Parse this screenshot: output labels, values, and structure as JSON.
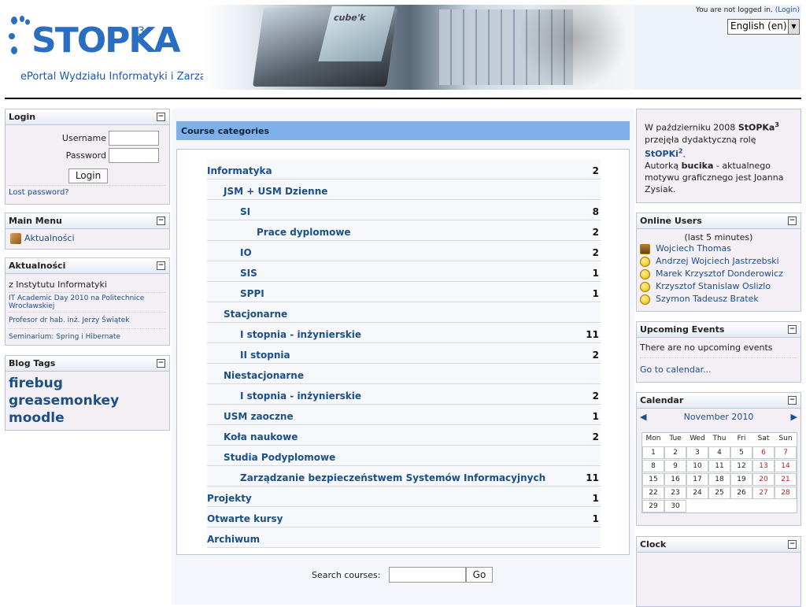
{
  "header": {
    "logo_main": "STOPKA",
    "logo_sup": "3",
    "portal_title": "ePortal Wydziału Informatyki i Zarządzania",
    "banner_screen_text": "cube'k",
    "login_status": "You are not logged in.",
    "login_link": "(Login)",
    "language": "English (en)"
  },
  "login_block": {
    "title": "Login",
    "username_label": "Username",
    "password_label": "Password",
    "login_button": "Login",
    "lost_password": "Lost password?"
  },
  "main_menu": {
    "title": "Main Menu",
    "items": [
      {
        "label": "Aktualności",
        "icon": "forum-icon"
      }
    ]
  },
  "news": {
    "title": "Aktualności",
    "heading": "z Instytutu Informatyki",
    "items": [
      "IT Academic Day 2010 na Politechnice Wrocławskiej",
      "Profesor dr hab. inż. Jerzy Świątek",
      "Seminarium: Spring i Hibernate"
    ]
  },
  "blog_tags": {
    "title": "Blog Tags",
    "tags": [
      "firebug",
      "greasemonkey",
      "moodle"
    ]
  },
  "course_categories": {
    "title": "Course categories",
    "rows": [
      {
        "name": "Informatyka",
        "count": "2",
        "level": 0
      },
      {
        "name": "JSM + USM Dzienne",
        "count": "",
        "level": 1
      },
      {
        "name": "SI",
        "count": "8",
        "level": 2
      },
      {
        "name": "Prace dyplomowe",
        "count": "2",
        "level": 3
      },
      {
        "name": "IO",
        "count": "2",
        "level": 2
      },
      {
        "name": "SIS",
        "count": "1",
        "level": 2
      },
      {
        "name": "SPPI",
        "count": "1",
        "level": 2
      },
      {
        "name": "Stacjonarne",
        "count": "",
        "level": 1
      },
      {
        "name": "I stopnia - inżynierskie",
        "count": "11",
        "level": 2
      },
      {
        "name": "II stopnia",
        "count": "2",
        "level": 2
      },
      {
        "name": "Niestacjonarne",
        "count": "",
        "level": 1
      },
      {
        "name": "I stopnia - inżynierskie",
        "count": "2",
        "level": 2
      },
      {
        "name": "USM zaoczne",
        "count": "1",
        "level": 1
      },
      {
        "name": "Koła naukowe",
        "count": "2",
        "level": 1
      },
      {
        "name": "Studia Podyplomowe",
        "count": "",
        "level": 1
      },
      {
        "name": "Zarządzanie bezpieczeństwem Systemów Informacyjnych",
        "count": "11",
        "level": 2
      },
      {
        "name": "Projekty",
        "count": "1",
        "level": 0
      },
      {
        "name": "Otwarte kursy",
        "count": "1",
        "level": 0
      },
      {
        "name": "Archiwum",
        "count": "",
        "level": 0
      }
    ],
    "search_label": "Search courses:",
    "go_button": "Go"
  },
  "notice": {
    "line1_a": "W październiku 2008 ",
    "line1_b": "StOPKa",
    "line1_sup": "3",
    "line2": " przejęła dydaktyczną rolę ",
    "line2_link": "StOPKi",
    "line2_sup": "2",
    "line2_end": ".",
    "line3_a": "Autorką ",
    "line3_b": "bucika",
    "line3_c": " - aktualnego motywu graficznego jest Joanna Zysiak."
  },
  "online_users": {
    "title": "Online Users",
    "subtitle": "(last 5 minutes)",
    "users": [
      {
        "name": "Wojciech Thomas",
        "avatar": "photo"
      },
      {
        "name": "Andrzej Wojciech Jastrzebski",
        "avatar": "smiley"
      },
      {
        "name": "Marek Krzysztof Donderowicz",
        "avatar": "smiley"
      },
      {
        "name": "Krzysztof Stanislaw Oslizlo",
        "avatar": "smiley"
      },
      {
        "name": "Szymon Tadeusz Bratek",
        "avatar": "smiley"
      }
    ]
  },
  "upcoming_events": {
    "title": "Upcoming Events",
    "text": "There are no upcoming events",
    "link": "Go to calendar..."
  },
  "calendar": {
    "title": "Calendar",
    "month": "November 2010",
    "prev": "◀",
    "next": "▶",
    "weekdays": [
      "Mon",
      "Tue",
      "Wed",
      "Thu",
      "Fri",
      "Sat",
      "Sun"
    ],
    "weeks": [
      [
        "1",
        "2",
        "3",
        "4",
        "5",
        "6",
        "7"
      ],
      [
        "8",
        "9",
        "10",
        "11",
        "12",
        "13",
        "14"
      ],
      [
        "15",
        "16",
        "17",
        "18",
        "19",
        "20",
        "21"
      ],
      [
        "22",
        "23",
        "24",
        "25",
        "26",
        "27",
        "28"
      ],
      [
        "29",
        "30",
        "",
        "",
        "",
        "",
        ""
      ]
    ]
  },
  "clock": {
    "title": "Clock"
  }
}
